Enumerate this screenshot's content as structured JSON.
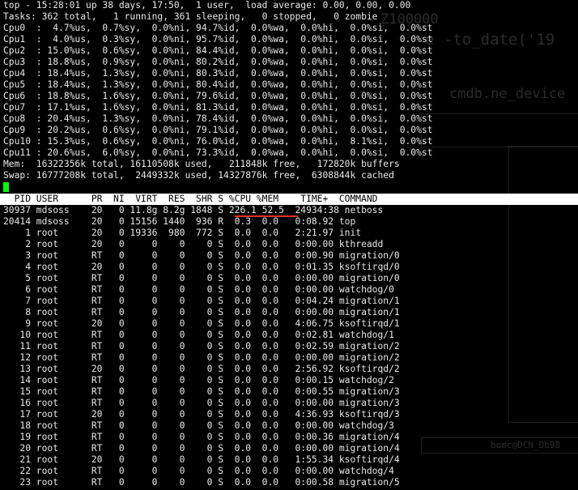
{
  "summary": [
    "top - 15:28:01 up 38 days, 17:50,  1 user,  load average: 0.00, 0.00, 0.00",
    "Tasks: 362 total,   1 running, 361 sleeping,   0 stopped,   0 zombie",
    "Cpu0  :  4.7%us,  0.7%sy,  0.0%ni, 94.7%id,  0.0%wa,  0.0%hi,  0.0%si,  0.0%st",
    "Cpu1  :  4.0%us,  0.3%sy,  0.0%ni, 95.7%id,  0.0%wa,  0.0%hi,  0.0%si,  0.0%st",
    "Cpu2  : 15.0%us,  0.6%sy,  0.0%ni, 84.4%id,  0.0%wa,  0.0%hi,  0.0%si,  0.0%st",
    "Cpu3  : 18.8%us,  0.9%sy,  0.0%ni, 80.2%id,  0.0%wa,  0.0%hi,  0.0%si,  0.0%st",
    "Cpu4  : 18.4%us,  1.3%sy,  0.0%ni, 80.3%id,  0.0%wa,  0.0%hi,  0.0%si,  0.0%st",
    "Cpu5  : 18.4%us,  1.3%sy,  0.0%ni, 80.4%id,  0.0%wa,  0.0%hi,  0.0%si,  0.0%st",
    "Cpu6  : 18.8%us,  1.6%sy,  0.0%ni, 79.6%id,  0.0%wa,  0.0%hi,  0.0%si,  0.0%st",
    "Cpu7  : 17.1%us,  1.6%sy,  0.0%ni, 81.3%id,  0.0%wa,  0.0%hi,  0.0%si,  0.0%st",
    "Cpu8  : 20.4%us,  1.3%sy,  0.0%ni, 78.4%id,  0.0%wa,  0.0%hi,  0.0%si,  0.0%st",
    "Cpu9  : 20.2%us,  0.6%sy,  0.0%ni, 79.1%id,  0.0%wa,  0.0%hi,  0.0%si,  0.0%st",
    "Cpu10 : 15.3%us,  0.6%sy,  0.0%ni, 76.0%id,  0.0%wa,  0.0%hi,  8.1%si,  0.0%st",
    "Cpu11 : 20.6%us,  6.0%sy,  0.0%ni, 73.3%id,  0.0%wa,  0.0%hi,  0.0%si,  0.0%st",
    "Mem:  16322356k total, 16110508k used,   211848k free,   172820k buffers",
    "Swap: 16777208k total,  2449332k used, 14327876k free,  6308844k cached"
  ],
  "columns": "  PID USER      PR  NI  VIRT  RES  SHR S %CPU %MEM    TIME+  COMMAND",
  "processes": [
    "30937 mdsoss    20   0 11.8g 8.2g 1848 S 226.1 52.5  24934:38 netboss",
    "20414 mdsoss    20   0 15156 1440  936 R  0.3  0.0   0:08.92 top",
    "    1 root      20   0 19336  980  772 S  0.0  0.0   2:21.97 init",
    "    2 root      20   0     0    0    0 S  0.0  0.0   0:00.00 kthreadd",
    "    3 root      RT   0     0    0    0 S  0.0  0.0   0:00.90 migration/0",
    "    4 root      20   0     0    0    0 S  0.0  0.0   0:01.35 ksoftirqd/0",
    "    5 root      RT   0     0    0    0 S  0.0  0.0   0:00.00 migration/0",
    "    6 root      RT   0     0    0    0 S  0.0  0.0   0:00.00 watchdog/0",
    "    7 root      RT   0     0    0    0 S  0.0  0.0   0:04.24 migration/1",
    "    8 root      RT   0     0    0    0 S  0.0  0.0   0:00.00 migration/1",
    "    9 root      20   0     0    0    0 S  0.0  0.0   4:06.75 ksoftirqd/1",
    "   10 root      RT   0     0    0    0 S  0.0  0.0   0:02.81 watchdog/1",
    "   11 root      RT   0     0    0    0 S  0.0  0.0   0:02.59 migration/2",
    "   12 root      RT   0     0    0    0 S  0.0  0.0   0:00.00 migration/2",
    "   13 root      20   0     0    0    0 S  0.0  0.0   2:56.92 ksoftirqd/2",
    "   14 root      RT   0     0    0    0 S  0.0  0.0   0:00.15 watchdog/2",
    "   15 root      RT   0     0    0    0 S  0.0  0.0   0:00.55 migration/3",
    "   16 root      RT   0     0    0    0 S  0.0  0.0   0:00.00 migration/3",
    "   17 root      20   0     0    0    0 S  0.0  0.0   4:36.93 ksoftirqd/3",
    "   18 root      RT   0     0    0    0 S  0.0  0.0   0:00.00 watchdog/3",
    "   19 root      RT   0     0    0    0 S  0.0  0.0   0:00.36 migration/4",
    "   20 root      RT   0     0    0    0 S  0.0  0.0   0:00.00 migration/4",
    "   21 root      20   0     0    0    0 S  0.0  0.0   1:55.34 ksoftirqd/4",
    "   22 root      RT   0     0    0    0 S  0.0  0.0   0:00.00 watchdog/4",
    "   23 root      RT   0     0    0    0 S  0.0  0.0   0:00.58 migration/5"
  ],
  "background": {
    "text1": "Z100000",
    "text2": "e -to_date('19",
    "text3": "cmdb.ne_device",
    "text4": "bomc@DCN_Db98"
  },
  "colors": {
    "terminal_bg": "#000000",
    "terminal_fg": "#e8e8e8",
    "header_bg": "#ffffff",
    "cursor": "#00ff00",
    "highlight_underline": "#e0302a"
  }
}
